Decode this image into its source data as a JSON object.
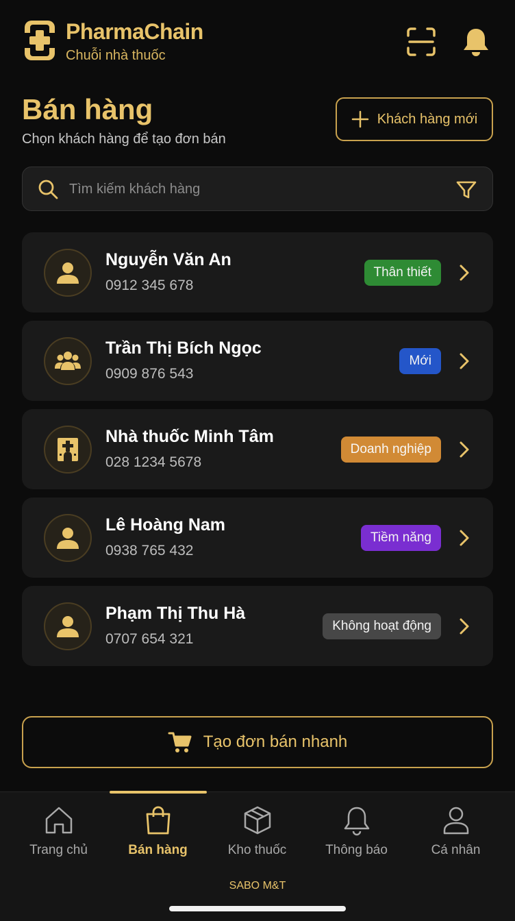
{
  "header": {
    "brand_name": "PharmaChain",
    "brand_sub": "Chuỗi nhà thuốc",
    "icons": [
      "scan-icon",
      "bell-icon"
    ]
  },
  "page": {
    "title": "Bán hàng",
    "subtitle": "Chọn khách hàng để tạo đơn bán",
    "new_customer_label": "Khách hàng mới"
  },
  "search": {
    "placeholder": "Tìm kiếm khách hàng",
    "value": ""
  },
  "customers": [
    {
      "name": "Nguyễn Văn An",
      "phone": "0912 345 678",
      "badge": "Thân thiết",
      "badge_color": "#2e8b34",
      "icon": "user-icon"
    },
    {
      "name": "Trần Thị Bích Ngọc",
      "phone": "0909 876 543",
      "badge": "Mới",
      "badge_color": "#2456c9",
      "icon": "group-icon"
    },
    {
      "name": "Nhà thuốc Minh Tâm",
      "phone": "028 1234 5678",
      "badge": "Doanh nghiệp",
      "badge_color": "#d18a35",
      "icon": "pharmacy-icon"
    },
    {
      "name": "Lê Hoàng Nam",
      "phone": "0938 765 432",
      "badge": "Tiềm năng",
      "badge_color": "#7a2ed1",
      "icon": "user-icon"
    },
    {
      "name": "Phạm Thị Thu Hà",
      "phone": "0707 654 321",
      "badge": "Không hoạt động",
      "badge_color": "#474747",
      "icon": "user-icon"
    }
  ],
  "quick_order": {
    "label": "Tạo đơn bán nhanh"
  },
  "nav": {
    "items": [
      {
        "label": "Trang chủ",
        "icon": "home-icon",
        "active": false
      },
      {
        "label": "Bán hàng",
        "icon": "shopping-bag-icon",
        "active": true
      },
      {
        "label": "Kho thuốc",
        "icon": "box-icon",
        "active": false
      },
      {
        "label": "Thông báo",
        "icon": "bell-icon",
        "active": false
      },
      {
        "label": "Cá nhân",
        "icon": "person-icon",
        "active": false
      }
    ],
    "footer_brand": "SABO M&T"
  },
  "colors": {
    "accent": "#e8c36a",
    "background": "#0c0c0c",
    "card": "#1a1a1a"
  }
}
